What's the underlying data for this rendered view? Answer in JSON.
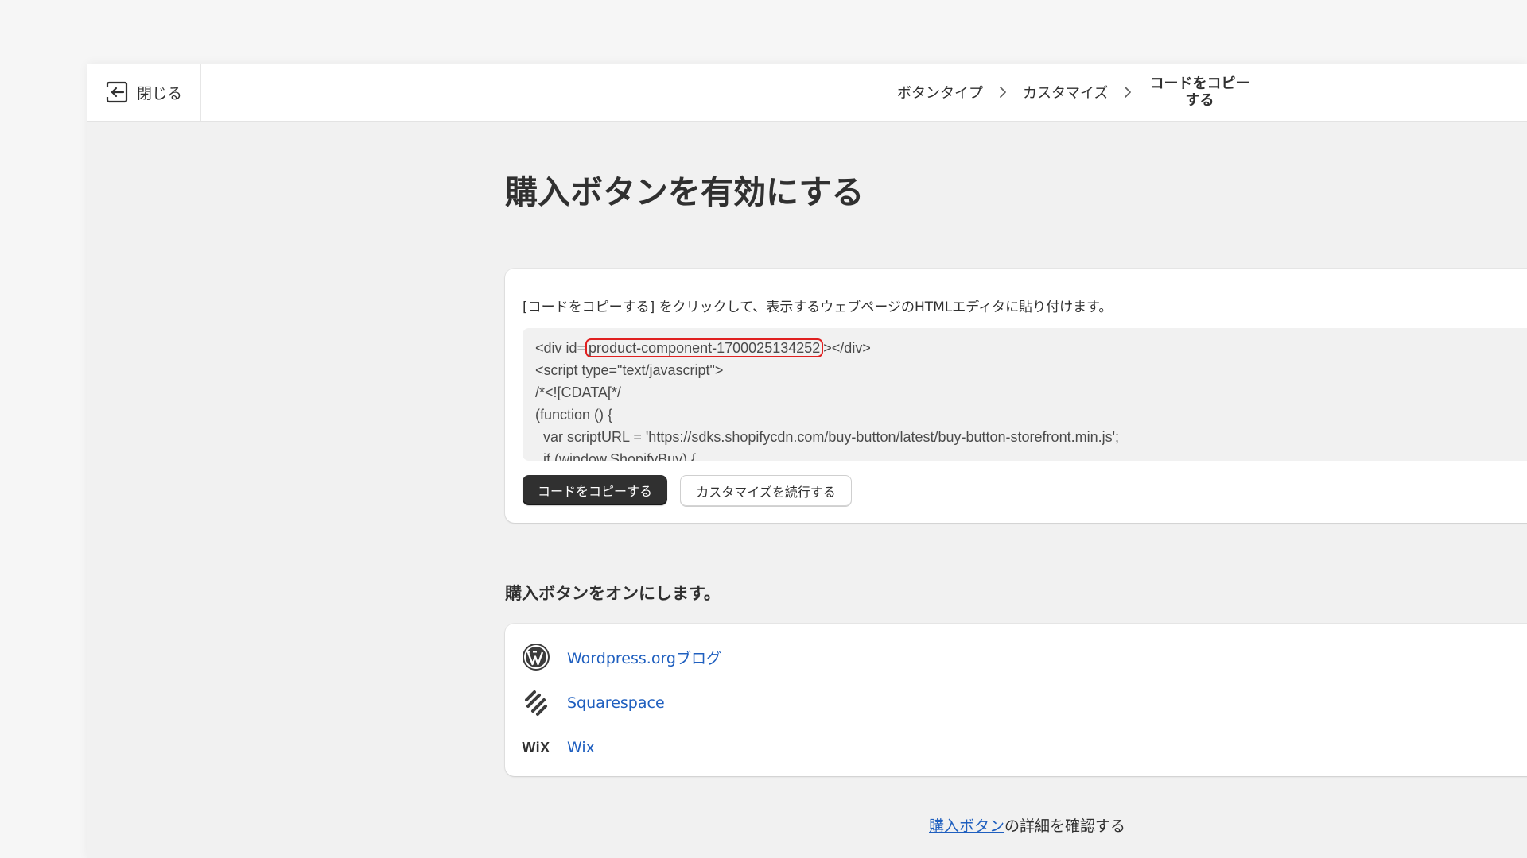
{
  "header": {
    "close_label": "閉じる",
    "breadcrumb": [
      {
        "label": "ボタンタイプ"
      },
      {
        "label": "カスタマイズ"
      },
      {
        "label": "コードをコピーする"
      }
    ]
  },
  "main": {
    "title": "購入ボタンを有効にする",
    "embed": {
      "description": "[コードをコピーする] をクリックして、表示するウェブページのHTMLエディタに貼り付けます。",
      "code": {
        "line1_prefix": "<div id=",
        "line1_highlight": "product-component-1700025134252",
        "line1_suffix": "></div>",
        "line2": "<script type=\"text/javascript\">",
        "line3": "/*<![CDATA[*/",
        "line4": "(function () {",
        "line5": "  var scriptURL = 'https://sdks.shopifycdn.com/buy-button/latest/buy-button-storefront.min.js';",
        "line6": "  if (window.ShopifyBuy) {"
      },
      "copy_button": "コードをコピーする",
      "continue_button": "カスタマイズを続行する"
    },
    "platforms": {
      "title": "購入ボタンをオンにします。",
      "items": [
        {
          "icon": "wordpress-icon",
          "label": "Wordpress.orgブログ"
        },
        {
          "icon": "squarespace-icon",
          "label": "Squarespace"
        },
        {
          "icon": "wix-icon",
          "logo_text": "WiX",
          "label": "Wix"
        }
      ]
    },
    "learn_more": {
      "link_text": "購入ボタン",
      "suffix": "の詳細を確認する"
    }
  },
  "colors": {
    "accent_link": "#1f5fbf",
    "primary_button": "#303030",
    "highlight_border": "#e02020",
    "page_background": "#f1f1f1"
  }
}
